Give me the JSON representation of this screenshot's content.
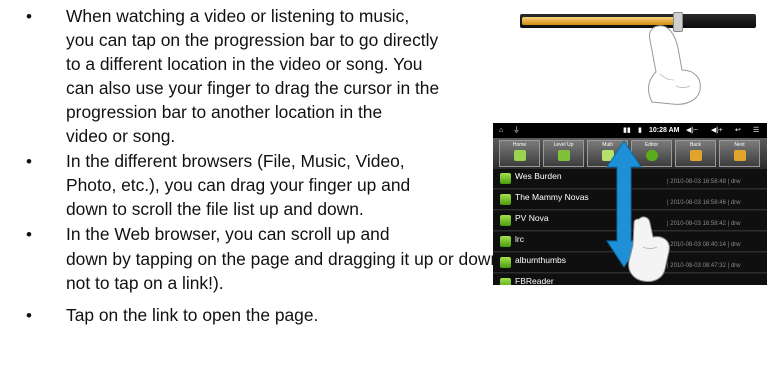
{
  "colors": {
    "text": "#111111",
    "accent_orange": "#d08a0f",
    "arrow_blue": "#1f8fd6",
    "folder_green": "#6cbf2a"
  },
  "progress_bar": {
    "fill_fraction": 0.66
  },
  "bullets": [
    {
      "lines": [
        "When watching a video or listening to music,",
        "you can tap on the progression bar to go directly",
        "to a different location in the video or song. You",
        "can also use your finger to drag the cursor in the",
        "progression bar to another location in the",
        "video or song."
      ]
    },
    {
      "lines": [
        "In the different browsers (File, Music, Video,",
        "Photo, etc.), you can drag your finger up and",
        "down to scroll the file list up and down."
      ]
    },
    {
      "lines": [
        "In the Web browser, you can scroll up and",
        "down by tapping on the page and dragging it up or down (be careful however",
        "not to tap on a link!)."
      ]
    },
    {
      "lines": [
        "Tap on the link to open the page."
      ]
    }
  ],
  "device_screenshot": {
    "status_bar": {
      "time": "10:28 AM"
    },
    "toolbar": [
      {
        "label": "Home",
        "icon": "home-icon"
      },
      {
        "label": "Level Up",
        "icon": "level-up-icon"
      },
      {
        "label": "Multi",
        "icon": "multi-select-icon"
      },
      {
        "label": "Editor",
        "icon": "editor-icon"
      },
      {
        "label": "Back",
        "icon": "back-icon"
      },
      {
        "label": "Next",
        "icon": "next-icon"
      }
    ],
    "files": [
      {
        "name": "Wes Burden",
        "meta": "| 2010-08-03 16:58:48 | drw"
      },
      {
        "name": "The Mammy Novas",
        "meta": "| 2010-08-03 16:58:46 | drw"
      },
      {
        "name": "PV Nova",
        "meta": "| 2010-08-03 16:58:42 | drw"
      },
      {
        "name": "lrc",
        "meta": "| 2010-08-03 08:40:14 | drw"
      },
      {
        "name": "albumthumbs",
        "meta": "| 2010-08-03 08:47:32 | drw"
      },
      {
        "name": "FBReader",
        "meta": ""
      }
    ]
  }
}
